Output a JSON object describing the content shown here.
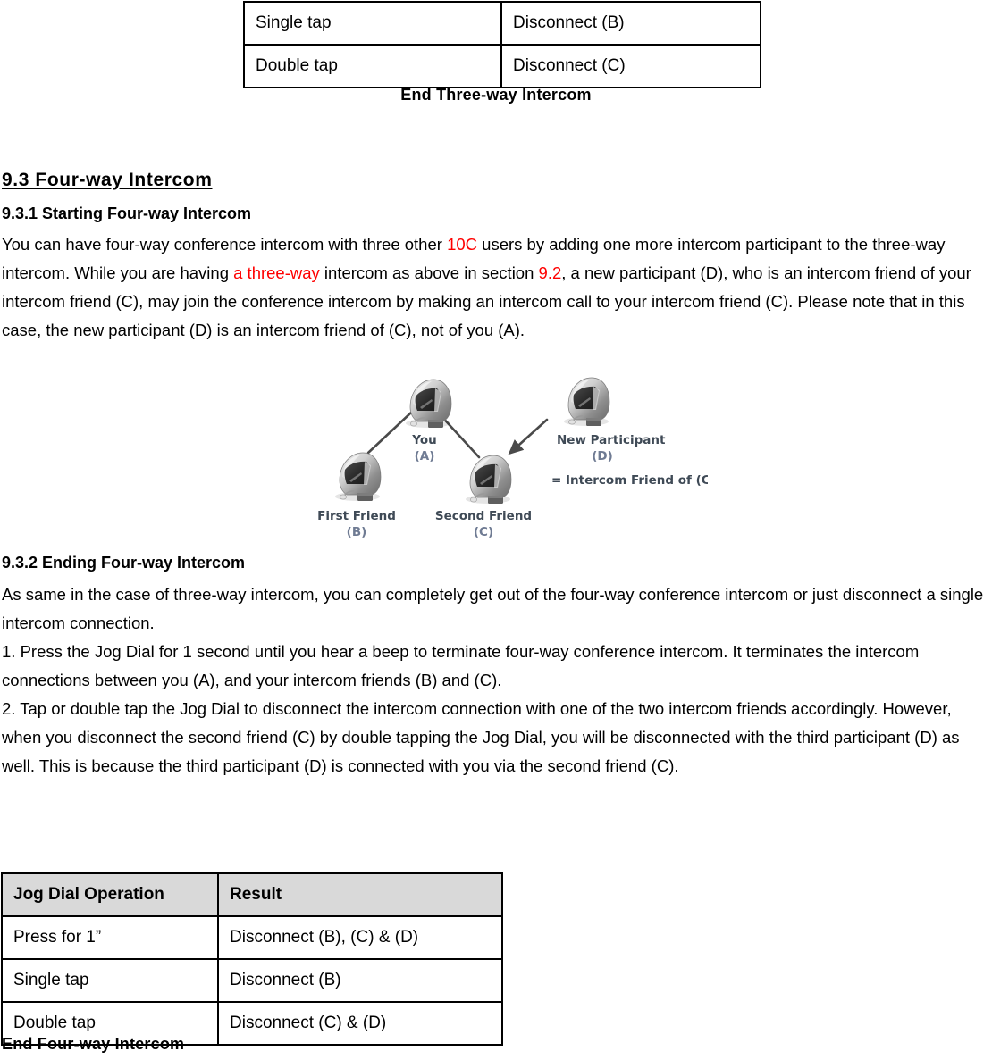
{
  "top_table": {
    "rows": [
      {
        "operation": "Single tap",
        "result": "Disconnect (B)"
      },
      {
        "operation": "Double tap",
        "result": "Disconnect (C)"
      }
    ],
    "caption": "End Three-way Intercom"
  },
  "section": {
    "number_title": "9.3 Four-way Intercom",
    "sub1_title": "9.3.1 Starting Four-way Intercom",
    "sub2_title": "9.3.2 Ending Four-way Intercom"
  },
  "paragraphs": {
    "starting": {
      "p1": "You can have four-way conference intercom with three other ",
      "red1": "10C",
      "p2": " users by adding one more intercom participant to the three-way intercom. While you are having ",
      "red2": "a three-way",
      "p3": " intercom as above in section ",
      "red3": "9.2",
      "p4": ", a new participant (D), who is an intercom friend of your intercom friend (C), may join the conference intercom by making an intercom call to your intercom friend (C). Please note that in this case, the new participant (D) is an intercom friend of (C), not of you (A)."
    },
    "ending_intro": "As same in the case of three-way intercom, you can completely get out of the four-way conference intercom or just disconnect a single intercom connection.",
    "step1": "1. Press the Jog Dial for 1 second until you hear a beep to terminate four-way conference intercom. It terminates the intercom connections between you (A), and your intercom friends (B) and (C).",
    "step2": "2. Tap or double tap the Jog Dial to disconnect the intercom connection with one of the two intercom friends accordingly. However, when you disconnect the second friend (C) by double tapping the Jog Dial, you will be disconnected with the third participant (D) as well. This is because the third participant (D) is connected with you via the second friend (C)."
  },
  "diagram": {
    "nodes": [
      {
        "name": "You",
        "id": "(A)"
      },
      {
        "name": "First Friend",
        "id": "(B)"
      },
      {
        "name": "Second Friend",
        "id": "(C)"
      },
      {
        "name": "New Participant",
        "id": "(D)"
      }
    ],
    "note": "= Intercom Friend of (C)",
    "label_color": "#3f4a56",
    "id_color": "#6f7b93"
  },
  "bottom_table": {
    "headers": [
      "Jog Dial Operation",
      "Result"
    ],
    "rows": [
      {
        "operation": "Press for 1”",
        "result": "Disconnect (B), (C) & (D)"
      },
      {
        "operation": "Single tap",
        "result": "Disconnect (B)"
      },
      {
        "operation": "Double tap",
        "result": "Disconnect (C) & (D)"
      }
    ],
    "caption": "End Four-way Intercom",
    "header_bg": "#d9d9d9"
  },
  "colors": {
    "highlight_red": "#ff0000",
    "text": "#000000",
    "table_border": "#000000"
  }
}
